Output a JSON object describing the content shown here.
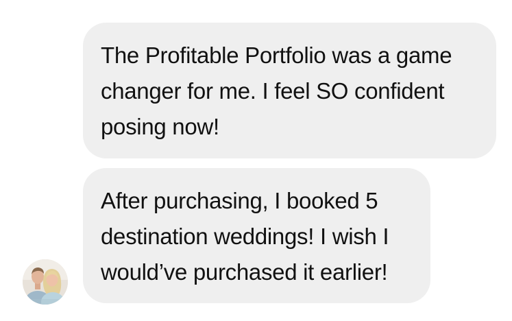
{
  "conversation": {
    "messages": [
      {
        "lines": [
          "The Profitable Portfolio was a game",
          "changer for me. I feel SO confident",
          "posing now!"
        ]
      },
      {
        "lines": [
          "After purchasing, I booked 5",
          "destination weddings! I wish I",
          "would’ve purchased it earlier!"
        ]
      }
    ],
    "sender_avatar": {
      "icon": "couple-photo-avatar"
    },
    "colors": {
      "bubble_background": "#efefef",
      "text": "#111111",
      "page_background": "#ffffff"
    }
  }
}
